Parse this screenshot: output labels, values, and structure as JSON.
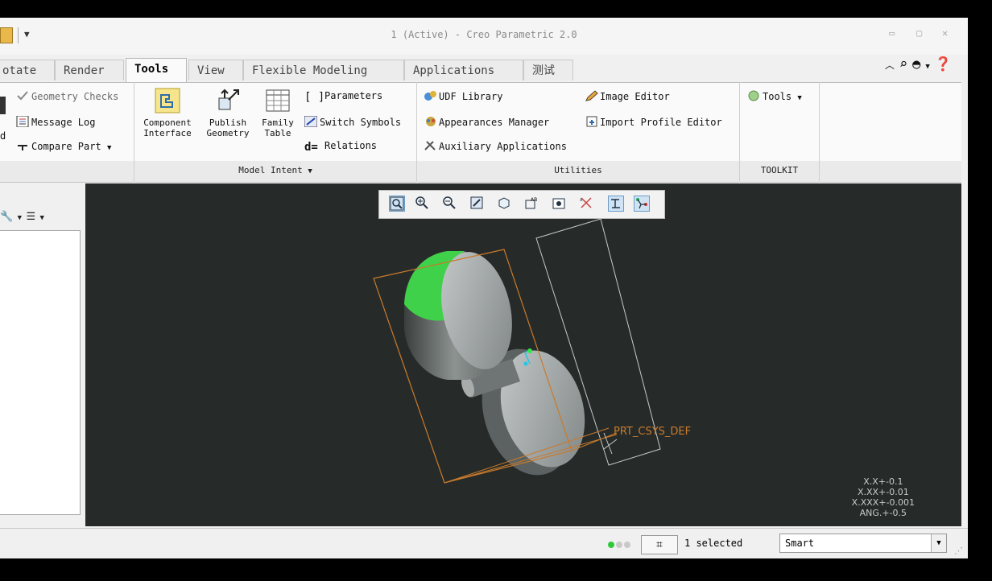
{
  "window": {
    "title": "1 (Active) - Creo Parametric 2.0",
    "controls": [
      "▭",
      "▢",
      "✕"
    ]
  },
  "tabs": [
    {
      "label": "otate",
      "active": false
    },
    {
      "label": "Render",
      "active": false
    },
    {
      "label": "Tools",
      "active": true
    },
    {
      "label": "View",
      "active": false
    },
    {
      "label": "Flexible Modeling",
      "active": false
    },
    {
      "label": "Applications",
      "active": false
    },
    {
      "label": "测试",
      "active": false
    }
  ],
  "ribbon": {
    "investigate": {
      "geometry_checks": "Geometry Checks",
      "message_log": "Message Log",
      "compare_part": "Compare Part",
      "partial_label": "d"
    },
    "model_intent": {
      "footer": "Model Intent",
      "component_interface": [
        "Component",
        "Interface"
      ],
      "publish_geometry": [
        "Publish",
        "Geometry"
      ],
      "family_table": [
        "Family",
        "Table"
      ],
      "parameters": "Parameters",
      "switch_symbols": "Switch Symbols",
      "relations": "Relations"
    },
    "utilities": {
      "footer": "Utilities",
      "udf_library": "UDF Library",
      "appearances_manager": "Appearances Manager",
      "auxiliary_applications": "Auxiliary Applications",
      "image_editor": "Image Editor",
      "import_profile_editor": "Import Profile Editor"
    },
    "toolkit": {
      "footer": "TOOLKIT",
      "tools": "Tools"
    }
  },
  "viewport": {
    "csys_label": "PRT_CSYS_DEF",
    "precision": [
      "X.X+-0.1",
      "X.XX+-0.01",
      "X.XXX+-0.001",
      "ANG.+-0.5"
    ],
    "part_color": "#3fd14a",
    "outline_color": "#c97a2c"
  },
  "status": {
    "selected": "1 selected",
    "filter_value": "Smart"
  }
}
